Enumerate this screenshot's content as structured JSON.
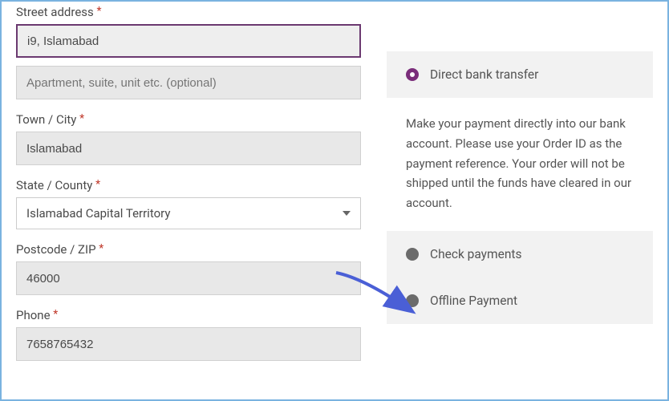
{
  "fields": {
    "street": {
      "label": "Street address",
      "value": "i9, Islamabad"
    },
    "address2": {
      "placeholder": "Apartment, suite, unit etc. (optional)"
    },
    "city": {
      "label": "Town / City",
      "value": "Islamabad"
    },
    "state": {
      "label": "State / County",
      "value": "Islamabad Capital Territory"
    },
    "postcode": {
      "label": "Postcode / ZIP",
      "value": "46000"
    },
    "phone": {
      "label": "Phone",
      "value": "7658765432"
    }
  },
  "required_mark": "*",
  "payment": {
    "options": {
      "bank": "Direct bank transfer",
      "check": "Check payments",
      "offline": "Offline Payment"
    },
    "bank_description": "Make your payment directly into our bank account. Please use your Order ID as the payment reference. Your order will not be shipped until the funds have cleared in our account."
  }
}
